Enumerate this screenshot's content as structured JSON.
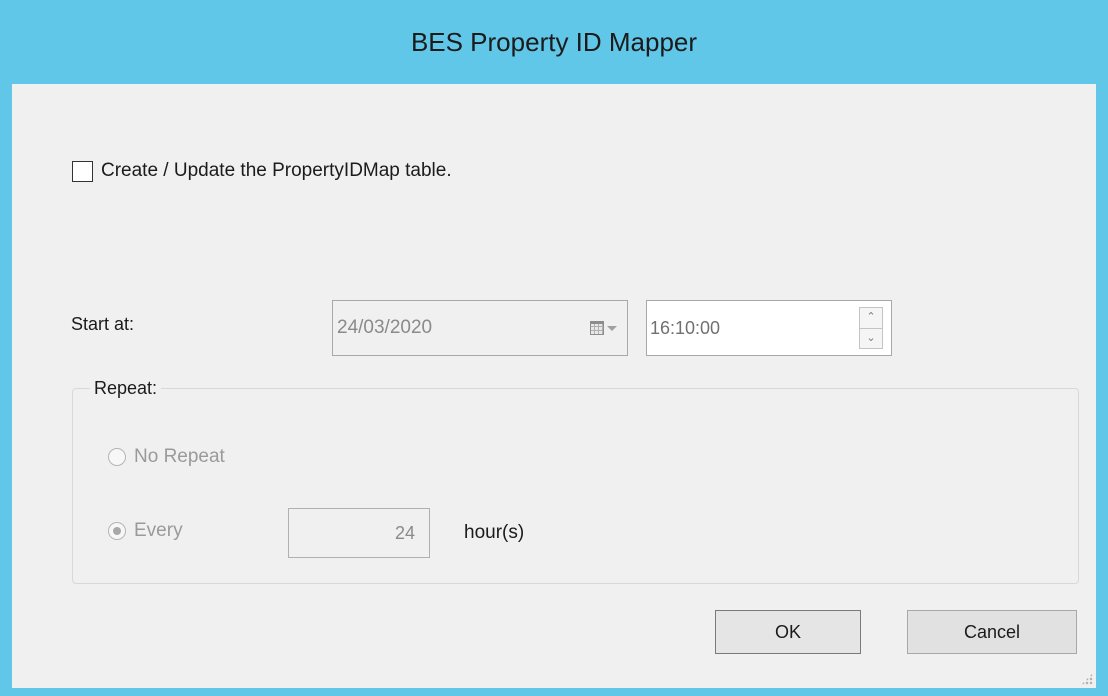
{
  "window": {
    "title": "BES Property ID Mapper",
    "accent_color": "#61c7e8",
    "background_color": "#f0f0f0"
  },
  "create_table": {
    "label": "Create / Update the PropertyIDMap table.",
    "checked": false
  },
  "start": {
    "label": "Start at:",
    "date_value": "24/03/2020",
    "date_icon": "calendar-icon",
    "time_value": "16:10:00"
  },
  "repeat": {
    "legend": "Repeat:",
    "no_repeat_label": "No Repeat",
    "every_label": "Every",
    "selected": "every",
    "hours_value": "24",
    "hours_unit": "hour(s)"
  },
  "buttons": {
    "ok_label": "OK",
    "cancel_label": "Cancel"
  }
}
